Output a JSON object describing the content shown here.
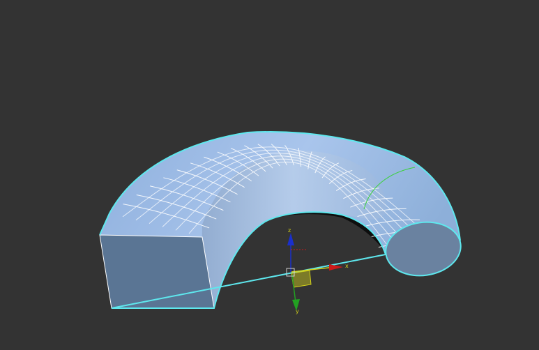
{
  "viewport": {
    "background": "#333333"
  },
  "object": {
    "surface_color": "#8fb0dd",
    "cap_color": "#5a7594",
    "wire_color": "#ffffff",
    "selection_color": "#5ee8ee",
    "seam_color": "#3ad13a"
  },
  "gizmo": {
    "x_label": "x",
    "y_label": "y",
    "z_label": "z",
    "x_color": "#cc1a1a",
    "y_color": "#22a022",
    "z_color": "#1a2fcc",
    "plane_color": "#d4d21a"
  }
}
